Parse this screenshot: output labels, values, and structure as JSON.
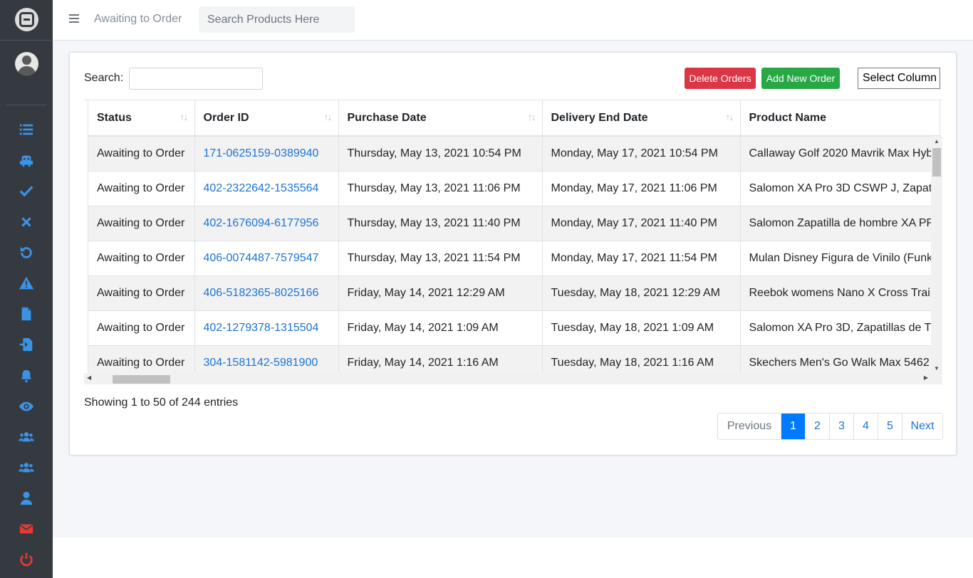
{
  "header": {
    "page_title": "Awaiting to Order",
    "search_placeholder": "Search Products Here"
  },
  "sidebar": {
    "icons": [
      {
        "name": "list-icon",
        "color": "#3b93e6"
      },
      {
        "name": "robot-icon",
        "color": "#3b93e6"
      },
      {
        "name": "check-icon",
        "color": "#3b93e6"
      },
      {
        "name": "times-icon",
        "color": "#3b93e6"
      },
      {
        "name": "undo-icon",
        "color": "#3b93e6"
      },
      {
        "name": "warning-icon",
        "color": "#3b93e6"
      },
      {
        "name": "file-icon",
        "color": "#3b93e6"
      },
      {
        "name": "file-import-icon",
        "color": "#3b93e6"
      },
      {
        "name": "bell-icon",
        "color": "#3b93e6"
      },
      {
        "name": "eye-icon",
        "color": "#3b93e6"
      },
      {
        "name": "users-icon",
        "color": "#3b93e6"
      },
      {
        "name": "users-group-icon",
        "color": "#3b93e6"
      },
      {
        "name": "user-icon",
        "color": "#3b93e6"
      },
      {
        "name": "envelope-icon",
        "color": "#e53935"
      },
      {
        "name": "power-icon",
        "color": "#e53935"
      }
    ]
  },
  "toolbar": {
    "search_label": "Search:",
    "delete_label": "Delete Orders",
    "add_label": "Add New Order",
    "select_column_label": "Select Column"
  },
  "table": {
    "columns": [
      "Status",
      "Order ID",
      "Purchase Date",
      "Delivery End Date",
      "Product Name"
    ],
    "rows": [
      [
        "Awaiting to Order",
        "171-0625159-0389940",
        "Thursday, May 13, 2021 10:54 PM",
        "Monday, May 17, 2021 10:54 PM",
        "Callaway Golf 2020 Mavrik Max Hyb"
      ],
      [
        "Awaiting to Order",
        "402-2322642-1535564",
        "Thursday, May 13, 2021 11:06 PM",
        "Monday, May 17, 2021 11:06 PM",
        "Salomon XA Pro 3D CSWP J, Zapat"
      ],
      [
        "Awaiting to Order",
        "402-1676094-6177956",
        "Thursday, May 13, 2021 11:40 PM",
        "Monday, May 17, 2021 11:40 PM",
        "Salomon Zapatilla de hombre XA PR"
      ],
      [
        "Awaiting to Order",
        "406-0074487-7579547",
        "Thursday, May 13, 2021 11:54 PM",
        "Monday, May 17, 2021 11:54 PM",
        "Mulan Disney Figura de Vinilo (Funk"
      ],
      [
        "Awaiting to Order",
        "406-5182365-8025166",
        "Friday, May 14, 2021 12:29 AM",
        "Tuesday, May 18, 2021 12:29 AM",
        "Reebok womens Nano X Cross Trai"
      ],
      [
        "Awaiting to Order",
        "402-1279378-1315504",
        "Friday, May 14, 2021 1:09 AM",
        "Tuesday, May 18, 2021 1:09 AM",
        "Salomon XA Pro 3D, Zapatillas de T"
      ],
      [
        "Awaiting to Order",
        "304-1581142-5981900",
        "Friday, May 14, 2021 1:16 AM",
        "Tuesday, May 18, 2021 1:16 AM",
        "Skechers Men's Go Walk Max 5462"
      ]
    ]
  },
  "footer": {
    "info": "Showing 1 to 50 of 244 entries",
    "prev_label": "Previous",
    "pages": [
      "1",
      "2",
      "3",
      "4",
      "5"
    ],
    "active_page": "1",
    "next_label": "Next"
  },
  "colors": {
    "sidebar_bg": "#343a40",
    "accent": "#007bff",
    "danger": "#dc3545",
    "success": "#28a745",
    "link": "#1a73d9"
  }
}
